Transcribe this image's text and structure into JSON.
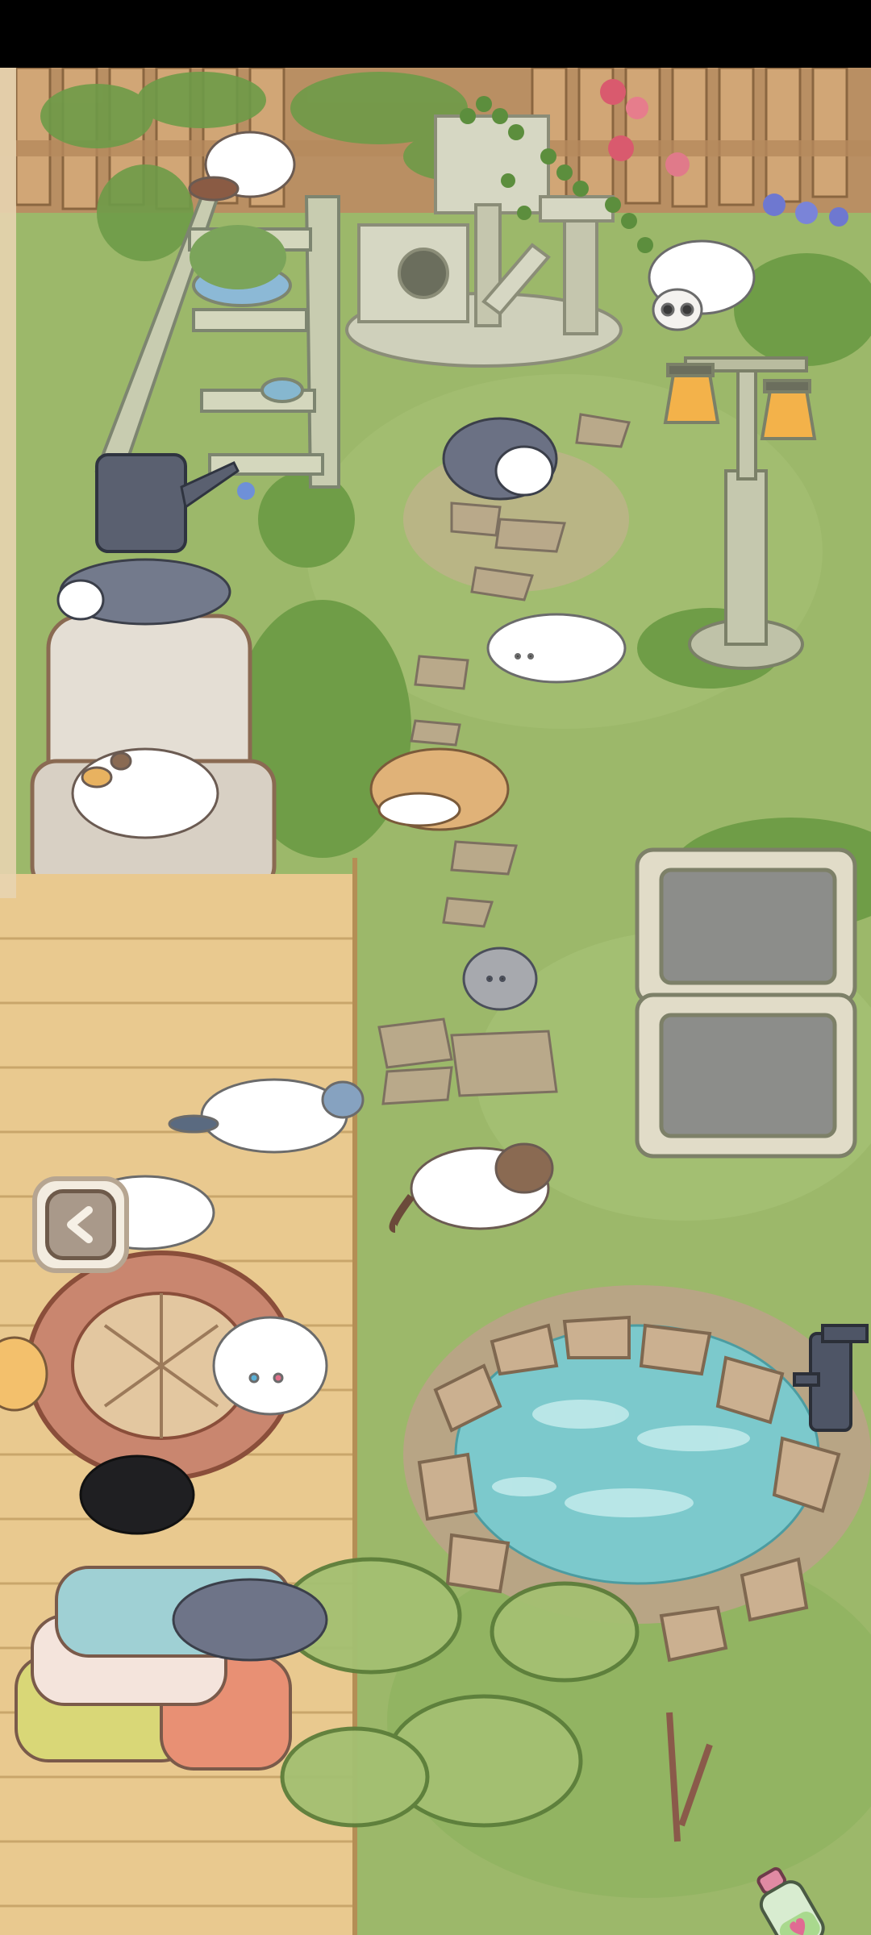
{
  "screen": "cat-garden",
  "colors": {
    "grass": "#9cb86a",
    "grass_dark": "#7ea656",
    "deck": "#e9c98f",
    "deck_line": "#c9a66b",
    "fence": "#c89a6a",
    "water": "#7cc9cc",
    "stone": "#c9a98a",
    "status_bar": "#000000"
  },
  "controls": {
    "back_icon": "chevron-left-icon",
    "potion_icon": "potion-bottle-heart-icon"
  },
  "scene_objects": [
    "wooden-fence",
    "step-ladder",
    "stone-cat-tower",
    "street-lamp",
    "armchair",
    "stepping-stone-path",
    "planter-boxes",
    "brick-well",
    "pond",
    "water-pump",
    "pillow-stack",
    "bushes"
  ],
  "cats": [
    "cat-on-ladder",
    "cat-on-tower",
    "cat-on-path-top",
    "cat-on-armchair-back",
    "cat-on-armchair-seat",
    "cat-lying-path",
    "cat-tan-curled",
    "cat-gray-small",
    "cat-on-deck",
    "cat-siamese",
    "cat-near-well",
    "cat-on-well",
    "cat-black-on-pillows",
    "cat-gray-on-pillows",
    "cat-peeking-edge"
  ]
}
